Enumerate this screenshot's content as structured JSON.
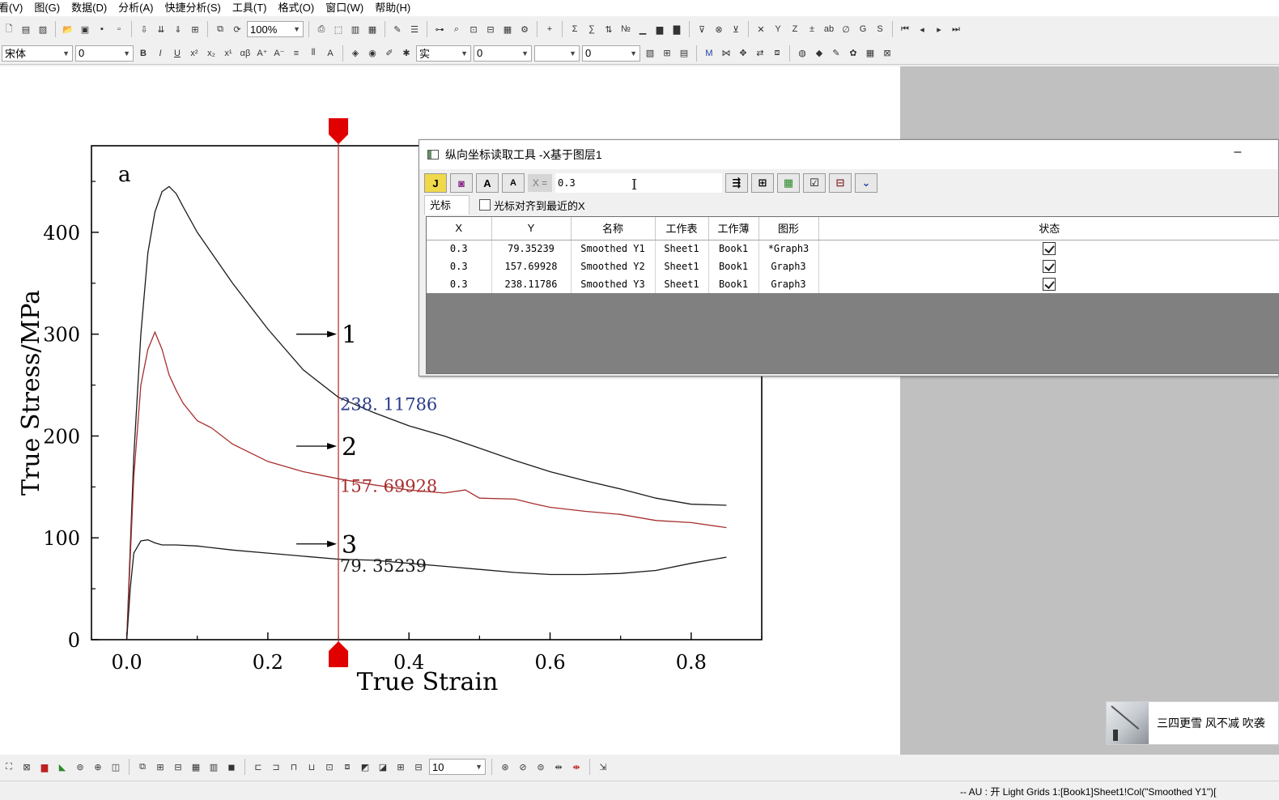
{
  "menu": [
    "看(V)",
    "图(G)",
    "数据(D)",
    "分析(A)",
    "快捷分析(S)",
    "工具(T)",
    "格式(O)",
    "窗口(W)",
    "帮助(H)"
  ],
  "toolbar1": {
    "zoom": "100%"
  },
  "toolbar2": {
    "font": "宋体",
    "font_size": "0",
    "line_style": "实",
    "line_width": "0",
    "number2": "0"
  },
  "bottom_toolbar": {
    "size": "10"
  },
  "tool_window": {
    "title": "纵向坐标读取工具 -X基于图层1",
    "minimize": "–",
    "x_label": "X =",
    "x_value": "0.3",
    "tab": "光标",
    "snap_label": "光标对齐到最近的X",
    "columns": [
      "X",
      "Y",
      "名称",
      "工作表",
      "工作薄",
      "图形",
      "状态"
    ],
    "rows": [
      {
        "x": "0.3",
        "y": "79.35239",
        "name": "Smoothed Y1",
        "sheet": "Sheet1",
        "book": "Book1",
        "graph": "*Graph3",
        "checked": true
      },
      {
        "x": "0.3",
        "y": "157.69928",
        "name": "Smoothed Y2",
        "sheet": "Sheet1",
        "book": "Book1",
        "graph": "Graph3",
        "checked": true
      },
      {
        "x": "0.3",
        "y": "238.11786",
        "name": "Smoothed Y3",
        "sheet": "Sheet1",
        "book": "Book1",
        "graph": "Graph3",
        "checked": true
      }
    ]
  },
  "chart_data": {
    "type": "line",
    "panel_label": "a",
    "xlabel": "True Strain",
    "ylabel": "True Stress/MPa",
    "xlim": [
      -0.05,
      0.9
    ],
    "ylim": [
      0,
      485
    ],
    "xticks": [
      "0.0",
      "0.2",
      "0.4",
      "0.6",
      "0.8"
    ],
    "yticks": [
      "0",
      "100",
      "200",
      "300",
      "400"
    ],
    "grid": false,
    "cursor_x": 0.3,
    "series": [
      {
        "color": "#1a1a1a",
        "x": [
          0.0,
          0.005,
          0.01,
          0.02,
          0.03,
          0.04,
          0.05,
          0.06,
          0.07,
          0.08,
          0.1,
          0.12,
          0.15,
          0.2,
          0.25,
          0.3,
          0.35,
          0.4,
          0.45,
          0.5,
          0.55,
          0.6,
          0.65,
          0.7,
          0.75,
          0.8,
          0.85
        ],
        "y": [
          0,
          90,
          180,
          300,
          380,
          420,
          440,
          445,
          438,
          425,
          400,
          380,
          350,
          305,
          265,
          238,
          223,
          210,
          200,
          188,
          176,
          165,
          156,
          148,
          139,
          133,
          132
        ]
      },
      {
        "color": "#a82e2e",
        "x": [
          0.0,
          0.005,
          0.01,
          0.02,
          0.03,
          0.04,
          0.05,
          0.06,
          0.07,
          0.08,
          0.1,
          0.12,
          0.15,
          0.2,
          0.25,
          0.3,
          0.35,
          0.4,
          0.45,
          0.48,
          0.5,
          0.55,
          0.58,
          0.6,
          0.65,
          0.7,
          0.75,
          0.8,
          0.85
        ],
        "y": [
          0,
          80,
          160,
          250,
          285,
          302,
          285,
          260,
          245,
          232,
          215,
          208,
          192,
          175,
          165,
          158,
          152,
          147,
          144,
          147,
          139,
          138,
          133,
          130,
          126,
          123,
          117,
          115,
          110
        ]
      },
      {
        "color": "#1a1a1a",
        "x": [
          0.0,
          0.005,
          0.01,
          0.02,
          0.03,
          0.04,
          0.05,
          0.07,
          0.1,
          0.15,
          0.2,
          0.25,
          0.3,
          0.35,
          0.4,
          0.45,
          0.5,
          0.55,
          0.6,
          0.65,
          0.7,
          0.75,
          0.8,
          0.85
        ],
        "y": [
          0,
          50,
          85,
          97,
          98,
          95,
          93,
          93,
          92,
          88,
          85,
          82,
          79,
          78,
          75,
          72,
          69,
          66,
          64,
          64,
          65,
          68,
          75,
          81
        ]
      }
    ],
    "curve_labels": [
      {
        "text": "1",
        "arrow_y": 300
      },
      {
        "text": "2",
        "arrow_y": 190
      },
      {
        "text": "3",
        "arrow_y": 94
      }
    ],
    "value_labels": [
      {
        "text": "238. 11786",
        "y": 238.11786,
        "color": "#2a3a8a"
      },
      {
        "text": "157. 69928",
        "y": 157.69928,
        "color": "#a82e2e"
      },
      {
        "text": "79. 35239",
        "y": 79.35239,
        "color": "#1a1a1a"
      }
    ]
  },
  "notification": {
    "text": "三四更雪 风不减 吹袭"
  },
  "status": {
    "text": "-- AU : 开 Light Grids 1:[Book1]Sheet1!Col(\"Smoothed Y1\")["
  }
}
